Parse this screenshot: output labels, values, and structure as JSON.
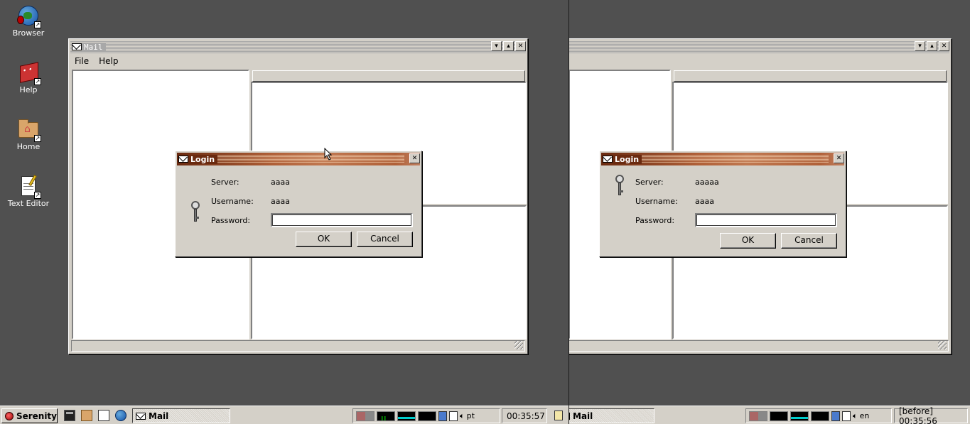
{
  "desktop": {
    "icons": [
      {
        "label": "Browser"
      },
      {
        "label": "Help"
      },
      {
        "label": "Home"
      },
      {
        "label": "Text Editor"
      }
    ]
  },
  "left": {
    "mail_window": {
      "title": "Mail",
      "menu": [
        "File",
        "Help"
      ]
    },
    "login": {
      "title": "Login",
      "server_label": "Server:",
      "server_value": "aaaa",
      "username_label": "Username:",
      "username_value": "aaaa",
      "password_label": "Password:",
      "password_value": "",
      "ok": "OK",
      "cancel": "Cancel"
    },
    "taskbar": {
      "start": "Serenity",
      "task": "Mail",
      "keyboard_layout": "pt",
      "clock": "00:35:57"
    }
  },
  "right": {
    "login": {
      "title": "Login",
      "server_label": "Server:",
      "server_value": "aaaaa",
      "username_label": "Username:",
      "username_value": "aaaa",
      "password_label": "Password:",
      "password_value": "",
      "ok": "OK",
      "cancel": "Cancel"
    },
    "taskbar": {
      "task": "Mail",
      "keyboard_layout": "en",
      "clock": "[before] 00:35:56"
    }
  },
  "colors": {
    "desktop": "#505050",
    "titlebar_active": "#b06038",
    "chrome": "#d4d0c8"
  }
}
